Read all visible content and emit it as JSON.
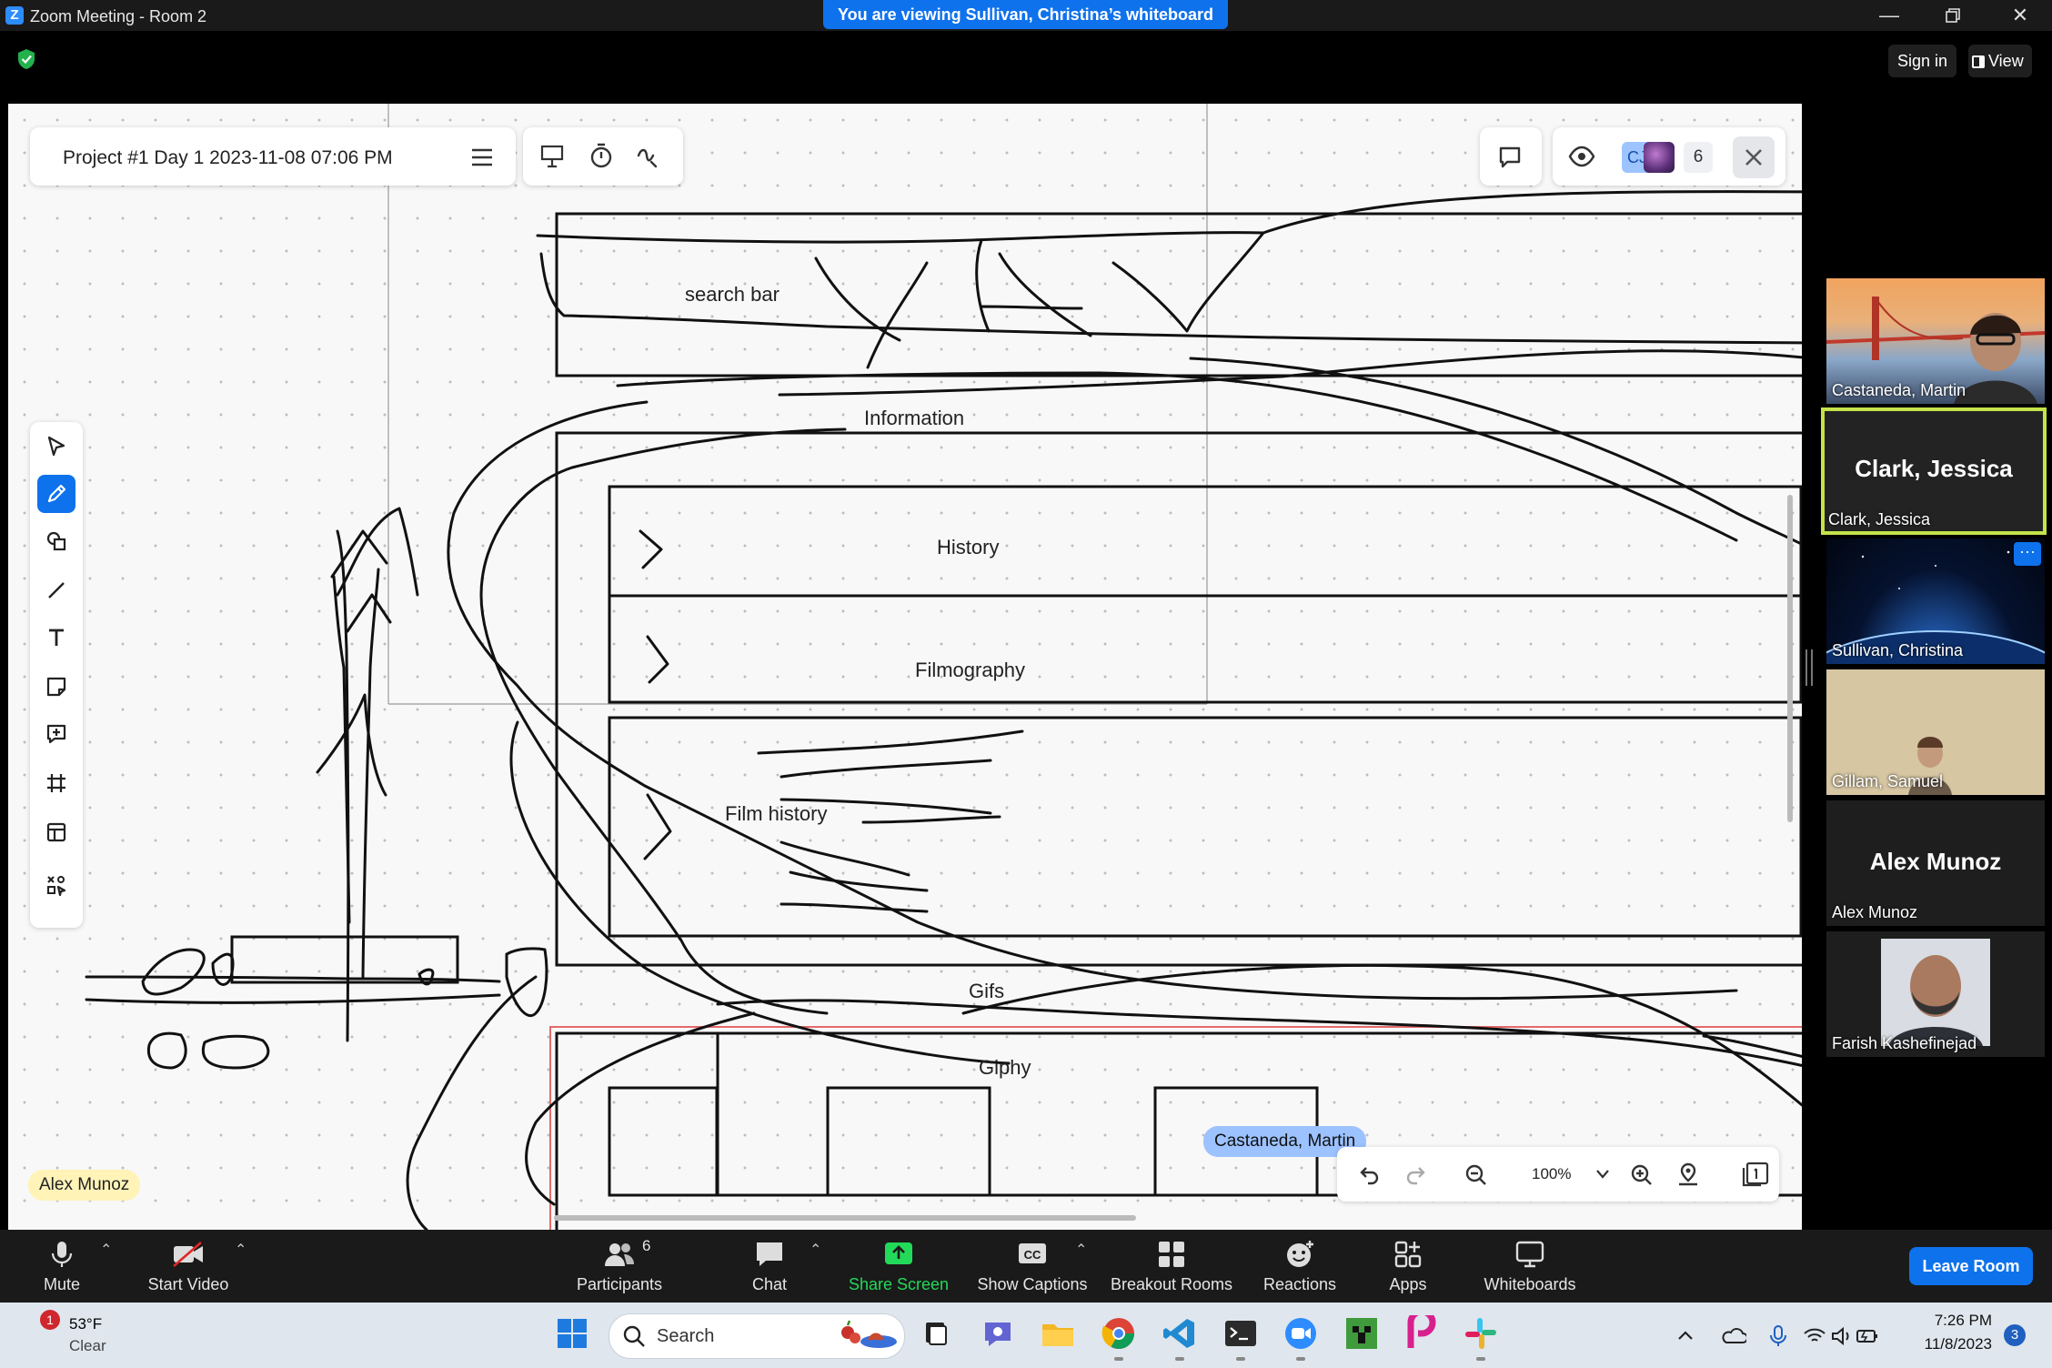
{
  "window": {
    "app_title": "Zoom Meeting - Room 2",
    "viewing_banner": "You are viewing Sullivan, Christina’s whiteboard",
    "controls": [
      "minimize",
      "restore",
      "close"
    ]
  },
  "top_right": {
    "sign_in": "Sign in",
    "view": "View"
  },
  "whiteboard": {
    "project_title": "Project #1 Day 1 2023-11-08 07:06 PM",
    "collab_initials": "CJ",
    "collab_count": "6",
    "canvas_labels": {
      "search_bar": "search bar",
      "information": "Information",
      "history": "History",
      "filmography": "Filmography",
      "film_history": "Film history",
      "gifs": "Gifs",
      "giphy": "Giphy"
    },
    "cursor_tags": {
      "user_tag": "Alex Munoz",
      "cursor_name": "Castaneda, Martin"
    },
    "zoom_level": "100%",
    "left_tools": [
      "select-icon",
      "pen-icon",
      "shapes-icon",
      "line-icon",
      "text-icon",
      "sticky-note-icon",
      "comment-icon",
      "frame-icon",
      "template-icon",
      "more-tools-icon"
    ]
  },
  "participants_gallery": [
    {
      "name": "Castaneda, Martin",
      "type": "video"
    },
    {
      "name": "Clark, Jessica",
      "display": "Clark, Jessica",
      "type": "name",
      "active_speaker": true
    },
    {
      "name": "Sullivan, Christina",
      "type": "video"
    },
    {
      "name": "Gillam, Samuel",
      "type": "video"
    },
    {
      "name": "Alex Munoz",
      "display": "Alex Munoz",
      "type": "name"
    },
    {
      "name": "Farish Kashefinejad",
      "type": "photo"
    }
  ],
  "meeting_toolbar": {
    "mute": "Mute",
    "start_video": "Start Video",
    "participants": "Participants",
    "participants_count": "6",
    "chat": "Chat",
    "share_screen": "Share Screen",
    "show_captions": "Show Captions",
    "breakout_rooms": "Breakout Rooms",
    "reactions": "Reactions",
    "apps": "Apps",
    "whiteboards": "Whiteboards",
    "leave_room": "Leave Room",
    "colors": {
      "accent": "#0e72ed",
      "share_green": "#23d959"
    }
  },
  "taskbar": {
    "weather_temp": "53°F",
    "weather_desc": "Clear",
    "weather_badge": "1",
    "search_placeholder": "Search",
    "time": "7:26 PM",
    "date": "11/8/2023",
    "notification_count": "3"
  }
}
